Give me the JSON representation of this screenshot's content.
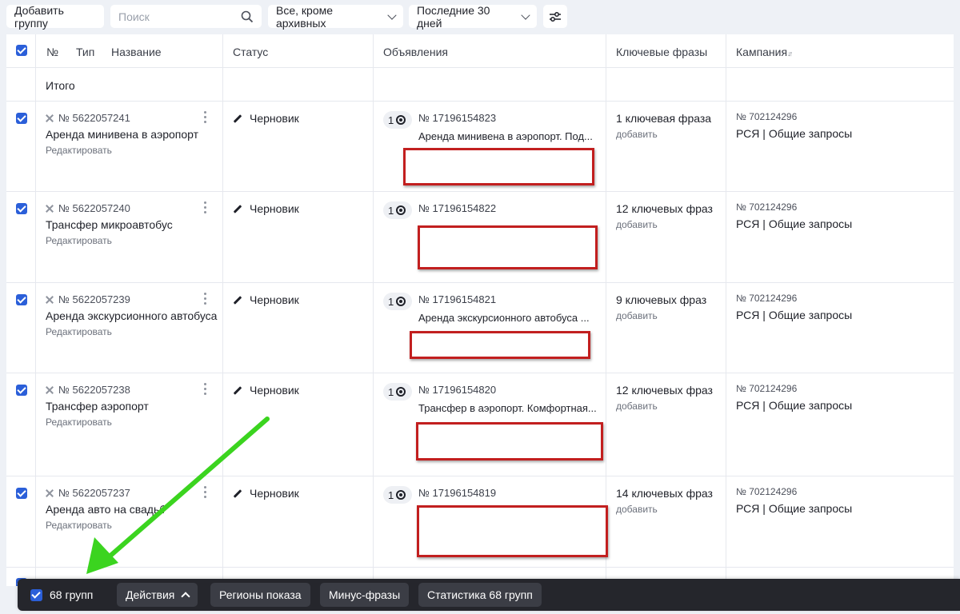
{
  "toolbar": {
    "add_group": "Добавить группу",
    "search_placeholder": "Поиск",
    "filter": "Все, кроме архивных",
    "period": "Последние 30 дней"
  },
  "header": {
    "num": "№",
    "type": "Тип",
    "name": "Название",
    "status": "Статус",
    "ads": "Объявления",
    "keywords": "Ключевые фразы",
    "campaign": "Кампания",
    "sort_glyph": "↓↑"
  },
  "total_label": "Итого",
  "edit_label": "Редактировать",
  "add_label": "добавить",
  "rows": [
    {
      "group_num": "№ 5622057241",
      "group_name": "Аренда минивена в аэропорт",
      "status": "Черновик",
      "ad_count": "1",
      "ad_num": "№ 17196154823",
      "ad_title": "Аренда минивена в аэропорт. Под...",
      "keywords": "1 ключевая фраза",
      "camp_num": "№ 702124296",
      "camp_name": "РСЯ | Общие запросы"
    },
    {
      "group_num": "№ 5622057240",
      "group_name": "Трансфер микроавтобус",
      "status": "Черновик",
      "ad_count": "1",
      "ad_num": "№ 17196154822",
      "ad_title": "",
      "keywords": "12 ключевых фраз",
      "camp_num": "№ 702124296",
      "camp_name": "РСЯ | Общие запросы"
    },
    {
      "group_num": "№ 5622057239",
      "group_name": "Аренда экскурсионного автобуса",
      "status": "Черновик",
      "ad_count": "1",
      "ad_num": "№ 17196154821",
      "ad_title": "Аренда экскурсионного автобуса ...",
      "keywords": "9 ключевых фраз",
      "camp_num": "№ 702124296",
      "camp_name": "РСЯ | Общие запросы"
    },
    {
      "group_num": "№ 5622057238",
      "group_name": "Трансфер аэропорт",
      "status": "Черновик",
      "ad_count": "1",
      "ad_num": "№ 17196154820",
      "ad_title": "Трансфер в аэропорт. Комфортная...",
      "keywords": "12 ключевых фраз",
      "camp_num": "№ 702124296",
      "camp_name": "РСЯ | Общие запросы"
    },
    {
      "group_num": "№ 5622057237",
      "group_name": "Аренда авто на свадьбу",
      "status": "Черновик",
      "ad_count": "1",
      "ad_num": "№ 17196154819",
      "ad_title": "",
      "keywords": "14 ключевых фраз",
      "camp_num": "№ 702124296",
      "camp_name": "РСЯ | Общие запросы"
    }
  ],
  "bottombar": {
    "count": "68 групп",
    "actions": "Действия",
    "regions": "Регионы показа",
    "minus": "Минус-фразы",
    "stats": "Статистика 68 групп"
  },
  "colors": {
    "accent": "#2b5fd9",
    "annotation_arrow": "#3bd41f",
    "redaction_border": "#c21f1f"
  }
}
